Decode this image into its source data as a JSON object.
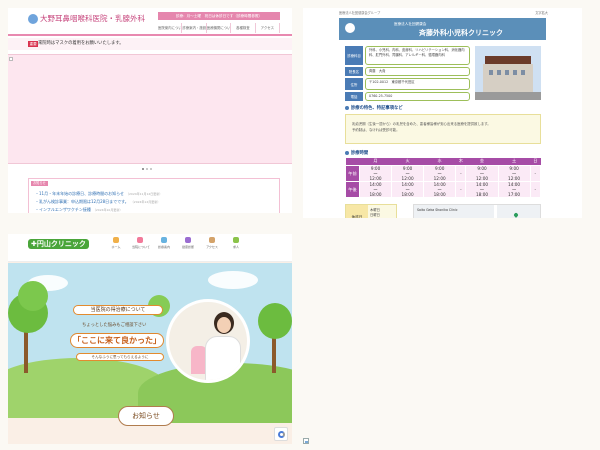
{
  "panel1": {
    "logo": "大野耳鼻咽喉科医院・乳腺外科",
    "info_bar": "診療：月〜土曜　祝日は休診日です（診療時間参照）",
    "nav": [
      "医院案内について",
      "診療案内・施設",
      "医療機関について",
      "各種検査",
      "アクセス"
    ],
    "notice_badge": "重要",
    "notice_text": "来院時はマスクの着用をお願いいたします。",
    "news_tab": "お知らせ",
    "news": [
      {
        "text": "11月・年末年始の診療日、診療時間のお知らせ",
        "date": "（2024年11月12日更新）"
      },
      {
        "text": "乳がん検診事業：申込期限は12月28日までです。",
        "date": "（2024年12月更新）"
      },
      {
        "text": "インフルエンザワクチン接種",
        "date": "（2024年10月更新）"
      }
    ]
  },
  "panel2": {
    "top_left": "医療法人社団健康会グループ",
    "top_right": "文字拡大",
    "banner_sub": "医療法人社団健康会",
    "banner_name": "斉藤外科小児科クリニック",
    "info": [
      {
        "key": "診療科目",
        "value": "外科、小児科、内科、皮膚科、リハビリテーション科、消化器内科、肛門外科、胃腸科、アレルギー科、循環器内科"
      },
      {
        "key": "院長名",
        "value": "斉藤　大貴"
      },
      {
        "key": "住所",
        "value": "〒102-0012　東京都千代田区"
      },
      {
        "key": "電話",
        "value": "0760-25-7500"
      }
    ],
    "features_title": "診療の特色、特記事項など",
    "features_text1": "乳幼児期（生後一週から）の乳児を含めた、患者様皆様が安心出来る医療を提供致します。",
    "features_text2": "予約制は、なければ受診可能。",
    "hours_title": "診療時間",
    "hours": {
      "days": [
        "",
        "月",
        "火",
        "水",
        "木",
        "金",
        "土",
        "日"
      ],
      "rows": [
        {
          "label": "午前",
          "cells": [
            "9:00\n〜\n12:00",
            "9:00\n〜\n12:00",
            "9:00\n〜\n12:00",
            "-",
            "9:00\n〜\n12:00",
            "9:00\n〜\n12:00",
            "-"
          ]
        },
        {
          "label": "午後",
          "cells": [
            "14:00\n〜\n18:00",
            "14:00\n〜\n18:00",
            "14:00\n〜\n18:00",
            "-",
            "14:00\n〜\n18:00",
            "14:00\n〜\n17:00",
            "-"
          ]
        }
      ]
    },
    "closed_key": "休診日",
    "closed_days": [
      "木曜日",
      "日曜日",
      "祝日"
    ],
    "map_title": "Saito Geka Shonika Clinic"
  },
  "panel3": {
    "logo": "円山クリニック",
    "nav": [
      {
        "label": "ホーム",
        "color": "#f0b04a"
      },
      {
        "label": "当院について",
        "color": "#f27a9a"
      },
      {
        "label": "診療案内",
        "color": "#68b3e0"
      },
      {
        "label": "健康診断",
        "color": "#9b6dd1"
      },
      {
        "label": "アクセス",
        "color": "#d4a36a"
      },
      {
        "label": "求人",
        "color": "#8bc34a"
      }
    ],
    "pill_a": "当医院の得治療について",
    "line_b": "ちょっとした悩みもご相談下さい",
    "pill_c": "「ここに来て良かった」",
    "line_d": "そんなふうに思ってもらえるように",
    "news_button": "お知らせ"
  }
}
